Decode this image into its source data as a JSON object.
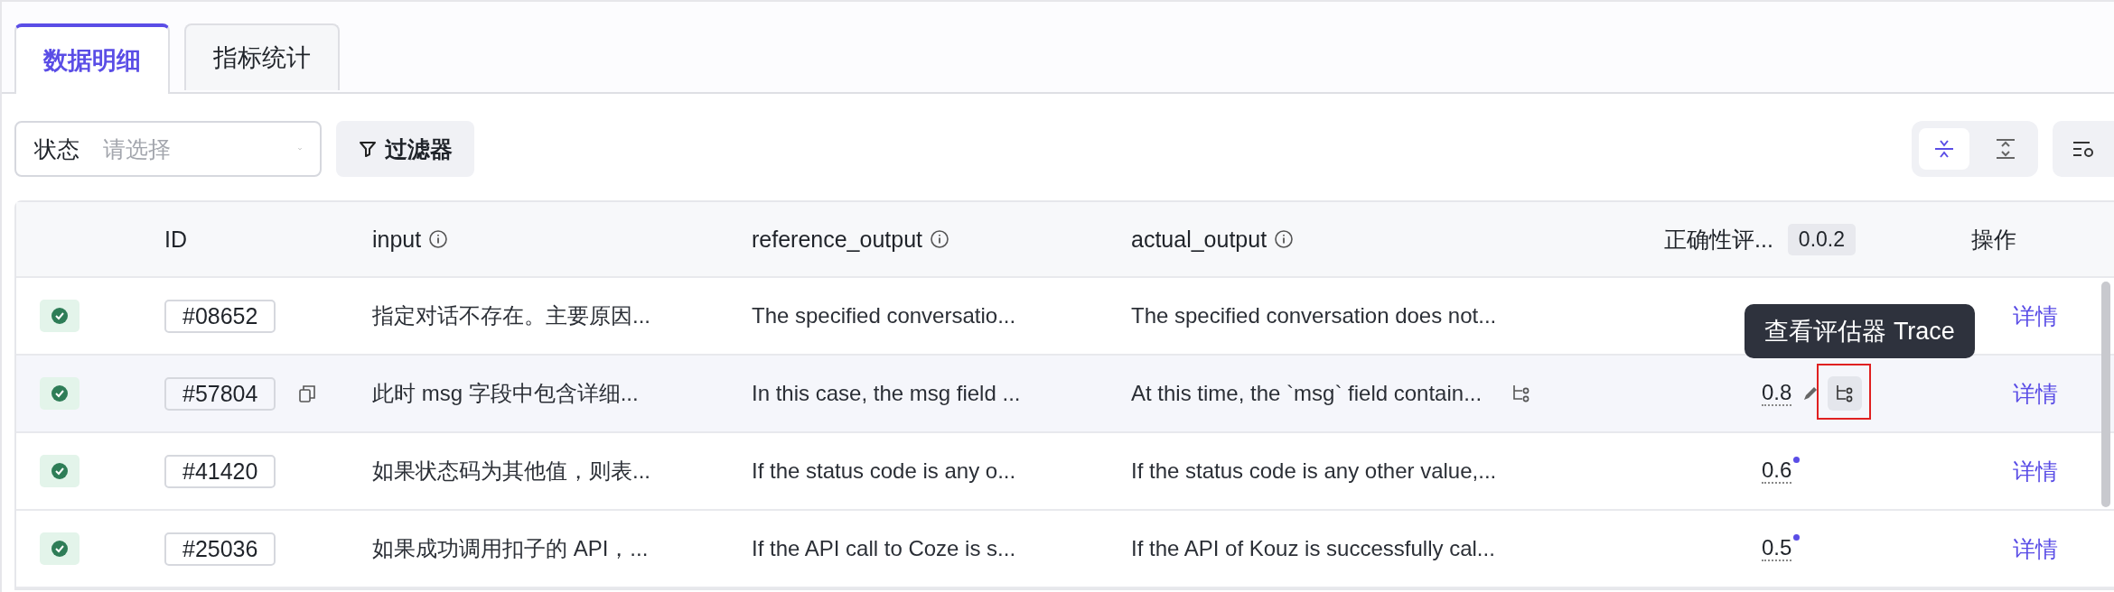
{
  "tabs": [
    {
      "label": "数据明细",
      "selected": true
    },
    {
      "label": "指标统计",
      "selected": false
    }
  ],
  "filter": {
    "label": "状态",
    "placeholder": "请选择"
  },
  "filter_button": {
    "label": "过滤器"
  },
  "view_toggle": [
    {
      "kind": "collapse",
      "selected": true
    },
    {
      "kind": "expand",
      "selected": false
    }
  ],
  "table": {
    "columns": [
      {
        "label": "ID"
      },
      {
        "label": "input",
        "info": true
      },
      {
        "label": "reference_output",
        "info": true
      },
      {
        "label": "actual_output",
        "info": true
      },
      {
        "label": "正确性评...",
        "badge": "0.0.2"
      },
      {
        "label": "操作"
      }
    ],
    "rows": [
      {
        "passed": true,
        "id": "#08652",
        "input": "指定对话不存在。主要原因...",
        "reference": "The specified conversatio...",
        "actual": "The specified conversation does not...",
        "hovered": false,
        "action": "详情"
      },
      {
        "passed": true,
        "id": "#57804",
        "input": "此时 msg 字段中包含详细...",
        "reference": "In this case, the msg field ...",
        "actual": "At this time, the `msg` field contain...",
        "score": "0.8",
        "dot": false,
        "hovered": true,
        "action": "详情",
        "tooltip": "查看评估器 Trace"
      },
      {
        "passed": true,
        "id": "#41420",
        "input": "如果状态码为其他值，则表...",
        "reference": "If the status code is any o...",
        "actual": "If the status code is any other value,...",
        "score": "0.6",
        "dot": true,
        "hovered": false,
        "action": "详情"
      },
      {
        "passed": true,
        "id": "#25036",
        "input": "如果成功调用扣子的 API，...",
        "reference": "If the API call to Coze is s...",
        "actual": "If the API of Kouz is successfully cal...",
        "score": "0.5",
        "dot": true,
        "hovered": false,
        "action": "详情"
      }
    ]
  }
}
